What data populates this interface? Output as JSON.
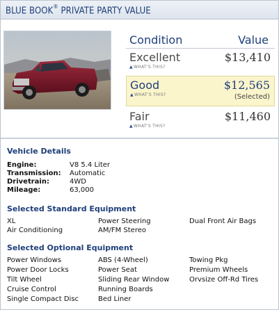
{
  "header": {
    "title_main": "BLUE BOOK",
    "title_reg": "®",
    "title_rest": " PRIVATE PARTY VALUE"
  },
  "values": {
    "condition_header": "Condition",
    "value_header": "Value",
    "what_label": "WHAT'S THIS?",
    "rows": [
      {
        "label": "Excellent",
        "price": "$13,410",
        "selected": false
      },
      {
        "label": "Good",
        "price": "$12,565",
        "selected": true,
        "selected_text": "(Selected)"
      },
      {
        "label": "Fair",
        "price": "$11,460",
        "selected": false
      }
    ]
  },
  "details": {
    "title": "Vehicle Details",
    "items": [
      {
        "label": "Engine:",
        "value": "V8 5.4 Liter"
      },
      {
        "label": "Transmission:",
        "value": "Automatic"
      },
      {
        "label": "Drivetrain:",
        "value": "4WD"
      },
      {
        "label": "Mileage:",
        "value": "63,000"
      }
    ]
  },
  "standard": {
    "title": "Selected Standard Equipment",
    "col1": [
      "XL",
      "Air Conditioning"
    ],
    "col2": [
      "Power Steering",
      "AM/FM Stereo"
    ],
    "col3": [
      "Dual Front Air Bags"
    ]
  },
  "optional": {
    "title": "Selected Optional Equipment",
    "col1": [
      "Power Windows",
      "Power Door Locks",
      "Tilt Wheel",
      "Cruise Control",
      "Single Compact Disc"
    ],
    "col2": [
      "ABS (4-Wheel)",
      "Power Seat",
      "Sliding Rear Window",
      "Running Boards",
      "Bed Liner"
    ],
    "col3": [
      "Towing Pkg",
      "Premium Wheels",
      "Orvsize Off-Rd Tires"
    ]
  },
  "colors": {
    "accent": "#1f3f7a",
    "selected_bg": "#fbf5cc",
    "truck": "#7a1a2a"
  }
}
